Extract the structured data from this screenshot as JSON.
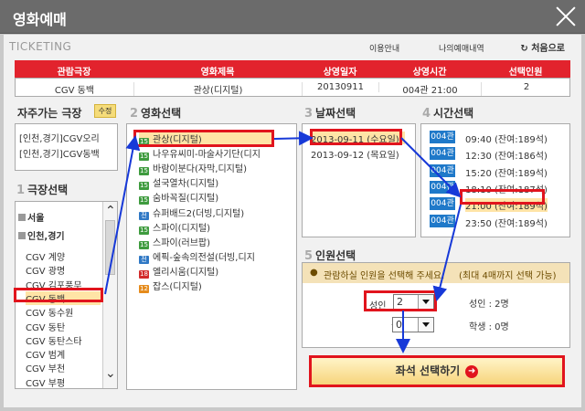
{
  "window": {
    "title": "영화예매",
    "close_label": "close"
  },
  "header": {
    "brand": "TICKETING",
    "links": [
      "이용안내",
      "나의예매내역"
    ],
    "restart": "처음으로"
  },
  "summary": {
    "headers": [
      "관람극장",
      "영화제목",
      "상영일자",
      "상영시간",
      "선택인원"
    ],
    "values": [
      "CGV 동백",
      "관상(디지털)",
      "20130911",
      "004관 21:00",
      "2"
    ]
  },
  "favorites": {
    "title": "자주가는 극장",
    "edit": "수정",
    "items": [
      "[인천,경기]CGV오리",
      "[인천,경기]CGV동백"
    ]
  },
  "theaters": {
    "step": "1",
    "title": "극장선택",
    "regions": [
      "서울",
      "인천,경기"
    ],
    "items": [
      "CGV 계양",
      "CGV 광명",
      "CGV 김포풍무",
      "CGV 동백",
      "CGV 동수원",
      "CGV 동탄",
      "CGV 동탄스타",
      "CGV 범계",
      "CGV 부천",
      "CGV 부평"
    ]
  },
  "movies": {
    "step": "2",
    "title": "영화선택",
    "items": [
      {
        "rating": "15",
        "title": "관상(디지털)"
      },
      {
        "rating": "15",
        "title": "나우유씨미-마술사기단(디지"
      },
      {
        "rating": "15",
        "title": "바람이분다(자막,디지털)"
      },
      {
        "rating": "15",
        "title": "설국열차(디지털)"
      },
      {
        "rating": "15",
        "title": "숨바꼭질(디지털)"
      },
      {
        "rating": "전",
        "title": "슈퍼배드2(더빙,디지털)"
      },
      {
        "rating": "15",
        "title": "스파이(디지털)"
      },
      {
        "rating": "15",
        "title": "스파이(러브팝)"
      },
      {
        "rating": "전",
        "title": "에픽-숲속의전설(더빙,디지"
      },
      {
        "rating": "18",
        "title": "엘리시움(디지털)"
      },
      {
        "rating": "12",
        "title": "잡스(디지털)"
      }
    ],
    "rating_colors": {
      "15": "#3e9b3e",
      "전": "#2f78c5",
      "18": "#d22b2b",
      "12": "#e58b1c"
    }
  },
  "dates": {
    "step": "3",
    "title": "날짜선택",
    "items": [
      "2013-09-11 (수요일)",
      "2013-09-12 (목요일)"
    ]
  },
  "times": {
    "step": "4",
    "title": "시간선택",
    "items": [
      {
        "hall": "004관",
        "time": "09:40 (잔여:189석)"
      },
      {
        "hall": "004관",
        "time": "12:30 (잔여:186석)"
      },
      {
        "hall": "004관",
        "time": "15:20 (잔여:189석)"
      },
      {
        "hall": "004관",
        "time": "18:10 (잔여:187석)"
      },
      {
        "hall": "004관",
        "time": "21:00 (잔여:189석)"
      },
      {
        "hall": "004관",
        "time": "23:50 (잔여:189석)"
      }
    ]
  },
  "people": {
    "step": "5",
    "title": "인원선택",
    "notice_prefix": "관람하실 인원을 선택해 주세요.",
    "notice_suffix": "(최대 4매까지 선택 가능)",
    "adult_label": "성인",
    "adult_value": "2",
    "student_label": "학생",
    "student_value": "0",
    "adult_count": "성인 : 2명",
    "student_count": "학생 : 0명"
  },
  "cta": {
    "label": "좌석 선택하기"
  },
  "colors": {
    "accent": "#e1141d",
    "time_badge": "#1f79c9",
    "arrow": "#1739d8"
  }
}
